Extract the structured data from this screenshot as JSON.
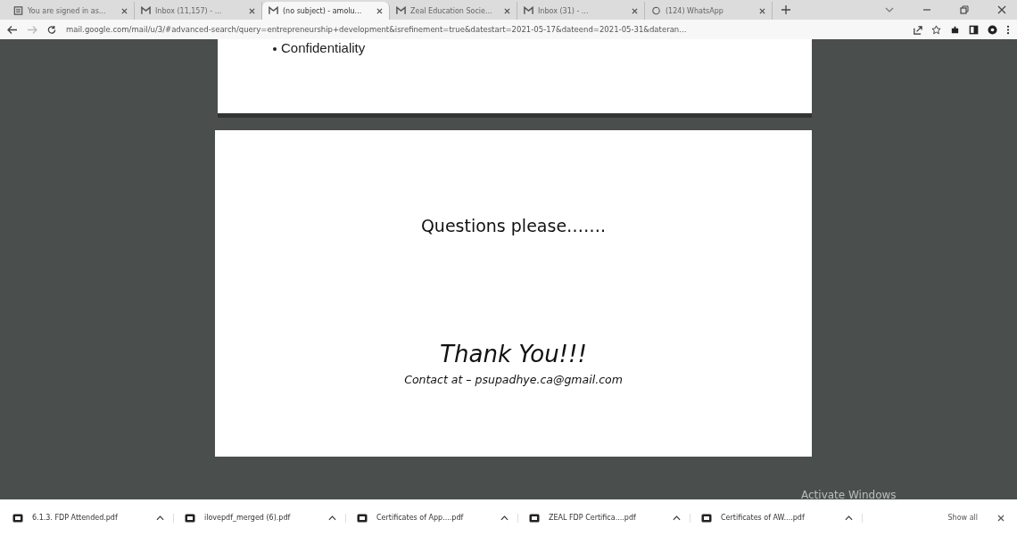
{
  "tabs": [
    {
      "title": "You are signed in as...",
      "kind": "doc",
      "selected": false
    },
    {
      "title": "Inbox (11,157) - ...",
      "kind": "mail",
      "selected": false
    },
    {
      "title": "(no subject) - amolu...",
      "kind": "mail",
      "selected": true
    },
    {
      "title": "Zeal Education Socie...",
      "kind": "mail",
      "selected": false
    },
    {
      "title": "Inbox (31) - ...",
      "kind": "mail",
      "selected": false
    },
    {
      "title": "(124) WhatsApp",
      "kind": "chat",
      "selected": false
    }
  ],
  "address_bar": {
    "url": "mail.google.com/mail/u/3/#advanced-search/query=entrepreneurship+development&isrefinement=true&datestart=2021-05-17&dateend=2021-05-31&dateran..."
  },
  "slides": [
    {
      "kind": "bullet",
      "text": "Confidentiality"
    },
    {
      "kind": "closing",
      "heading": "Questions please…….",
      "thanks": "Thank You!!!",
      "contact": "Contact at – psupadhye.ca@gmail.com"
    }
  ],
  "os_notice": "Activate Windows",
  "downloads": [
    {
      "file": "6.1.3. FDP Attended.pdf"
    },
    {
      "file": "ilovepdf_merged (6).pdf"
    },
    {
      "file": "Certificates of App....pdf"
    },
    {
      "file": "ZEAL FDP Certifica....pdf"
    },
    {
      "file": "Certificates of AW....pdf"
    }
  ],
  "show_all": "Show all"
}
